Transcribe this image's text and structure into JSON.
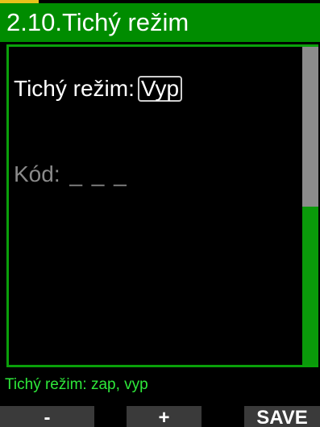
{
  "header": {
    "title": "2.10.Tichý režim"
  },
  "settings": {
    "mode_label": "Tichý režim:",
    "mode_value": "Vyp",
    "code_label": "Kód:",
    "code_value": "_ _ _"
  },
  "help": {
    "text": "Tichý režim: zap, vyp"
  },
  "softkeys": {
    "minus": "-",
    "plus": "+",
    "save": "SAVE"
  },
  "colors": {
    "title_bar": "#008c00",
    "frame": "#0aa00a",
    "help_text": "#2ee83a",
    "scroll_thumb": "#8c8c8c",
    "softkey_bg": "#3a3a3a"
  }
}
